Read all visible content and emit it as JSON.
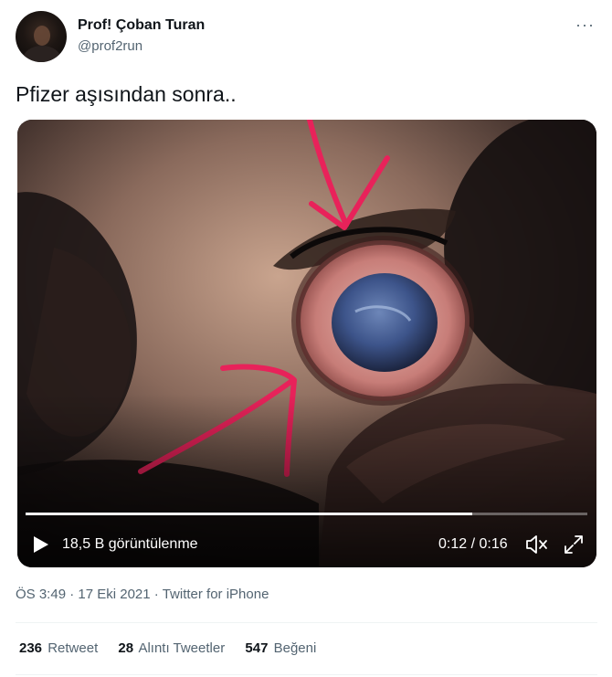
{
  "author": {
    "name": "Prof! Çoban Turan",
    "handle": "@prof2run"
  },
  "more_label": "···",
  "tweet": {
    "text": "Pfizer aşısından sonra.."
  },
  "video": {
    "views_label": "18,5 B görüntülenme",
    "time_current": "0:12",
    "time_total": "0:16",
    "time_label": "0:12 / 0:16",
    "progress": 0.795,
    "annotation_color": "#e8225a"
  },
  "meta": {
    "time": "ÖS 3:49",
    "separator": " · ",
    "date": "17 Eki 2021",
    "source": "Twitter for iPhone"
  },
  "stats": [
    {
      "count": "236",
      "label": "Retweet"
    },
    {
      "count": "28",
      "label": "Alıntı Tweetler"
    },
    {
      "count": "547",
      "label": "Beğeni"
    }
  ],
  "colors": {
    "text_primary": "#0f1419",
    "text_secondary": "#536471",
    "divider": "#eff3f4"
  }
}
